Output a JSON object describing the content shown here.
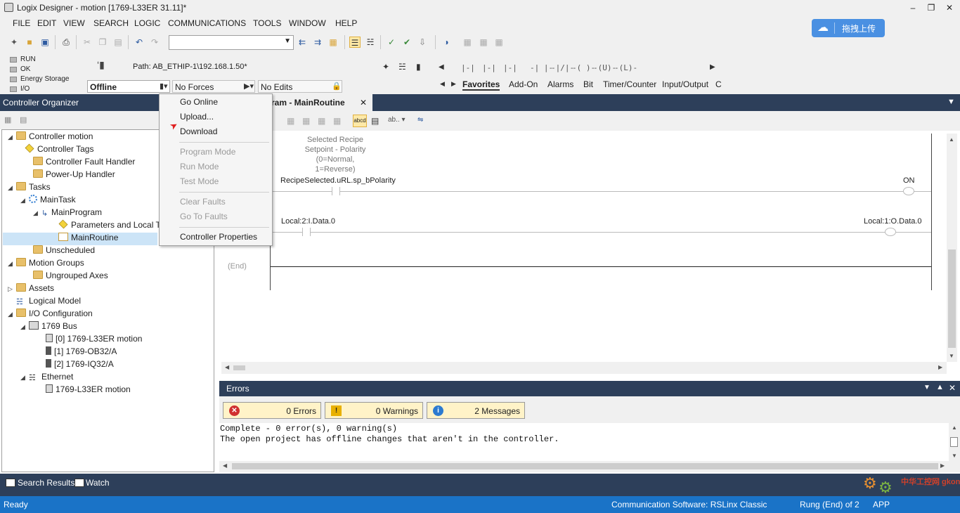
{
  "window": {
    "title": "Logix Designer - motion [1769-L33ER 31.11]*"
  },
  "menu": [
    "FILE",
    "EDIT",
    "VIEW",
    "SEARCH",
    "LOGIC",
    "COMMUNICATIONS",
    "TOOLS",
    "WINDOW",
    "HELP"
  ],
  "toolbar": {
    "combo_value": ""
  },
  "cloud_button": {
    "label": "拖拽上传"
  },
  "status_panel": {
    "leds": [
      "RUN",
      "OK",
      "Energy Storage",
      "I/O"
    ],
    "path": "Path: AB_ETHIP-1\\192.168.1.50*",
    "mode": "Offline",
    "forces": "No Forces",
    "edits": "No Edits"
  },
  "instruction_palette": {
    "glyphs": [
      "|-|",
      "|-|",
      "|-|",
      "-| |-",
      "-|/|-",
      "-( )-",
      "-(U)-",
      "-(L)-"
    ],
    "categories": [
      "Favorites",
      "Add-On",
      "Alarms",
      "Bit",
      "Timer/Counter",
      "Input/Output",
      "C"
    ]
  },
  "organizer": {
    "title": "Controller Organizer",
    "tree": [
      {
        "label": "Controller motion",
        "expanded": true
      },
      {
        "label": "Controller Tags"
      },
      {
        "label": "Controller Fault Handler"
      },
      {
        "label": "Power-Up Handler"
      },
      {
        "label": "Tasks",
        "expanded": true
      },
      {
        "label": "MainTask",
        "expanded": true
      },
      {
        "label": "MainProgram",
        "expanded": true
      },
      {
        "label": "Parameters and Local T"
      },
      {
        "label": "MainRoutine",
        "selected": true
      },
      {
        "label": "Unscheduled"
      },
      {
        "label": "Motion Groups",
        "expanded": true
      },
      {
        "label": "Ungrouped Axes"
      },
      {
        "label": "Assets",
        "expanded": false
      },
      {
        "label": "Logical Model"
      },
      {
        "label": "I/O Configuration",
        "expanded": true
      },
      {
        "label": "1769 Bus",
        "expanded": true
      },
      {
        "label": "[0] 1769-L33ER motion"
      },
      {
        "label": "[1] 1769-OB32/A"
      },
      {
        "label": "[2] 1769-IQ32/A"
      },
      {
        "label": "Ethernet",
        "expanded": true
      },
      {
        "label": "1769-L33ER motion"
      }
    ]
  },
  "context_menu": {
    "items": [
      {
        "label": "Go Online",
        "enabled": true
      },
      {
        "label": "Upload...",
        "enabled": true
      },
      {
        "label": "Download",
        "enabled": true
      },
      {
        "label": "Program Mode",
        "enabled": false
      },
      {
        "label": "Run Mode",
        "enabled": false
      },
      {
        "label": "Test Mode",
        "enabled": false
      },
      {
        "label": "Clear Faults",
        "enabled": false
      },
      {
        "label": "Go To Faults",
        "enabled": false
      },
      {
        "label": "Controller Properties",
        "enabled": true
      }
    ]
  },
  "editor": {
    "tab_title": "ram - MainRoutine",
    "rung0": {
      "comment": [
        "Selected Recipe",
        "Setpoint - Polarity",
        "(0=Normal,",
        "1=Reverse)"
      ],
      "contact_tag": "RecipeSelected.uRL.sp_bPolarity",
      "coil_tag": "ON"
    },
    "rung1": {
      "contact_tag": "Local:2:I.Data.0",
      "coil_tag": "Local:1:O.Data.0"
    },
    "end_label": "(End)"
  },
  "errors": {
    "title": "Errors",
    "errors_count": "0 Errors",
    "warnings_count": "0 Warnings",
    "messages_count": "2 Messages",
    "output": [
      "Complete - 0 error(s), 0 warning(s)",
      "The open project has offline changes that aren't in the controller."
    ]
  },
  "bottom_tabs": [
    "Search Results",
    "Watch"
  ],
  "status_bar": {
    "left": "Ready",
    "comm": "Communication Software: RSLinx Classic",
    "rung": "Rung (End) of 2",
    "app": "APP"
  },
  "watermark": "中华工控网 gkong.com",
  "colors": {
    "dark_header": "#2d3f5a",
    "status_bar": "#1a73c7",
    "chrome": "#f0f0f0",
    "cloud_button": "#4a90e2",
    "selection": "#cce4f7"
  }
}
